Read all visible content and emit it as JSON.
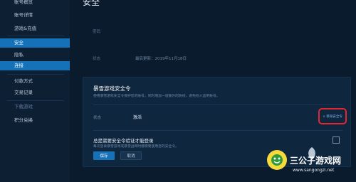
{
  "sidebar": {
    "items": [
      {
        "label": "账号概览"
      },
      {
        "label": "账号详情"
      },
      {
        "label": "游戏&充值"
      },
      {
        "label": "安全"
      },
      {
        "label": "隐私"
      },
      {
        "label": "连接"
      },
      {
        "label": "付款方式"
      },
      {
        "label": "交易记录"
      },
      {
        "label": "下载游戏"
      },
      {
        "label": "积分兑换"
      }
    ]
  },
  "page": {
    "title": "安全",
    "password_label": "密码",
    "updated_label": "状态",
    "updated_value": "最后更新：2019年11月18日"
  },
  "authenticator": {
    "title": "暴雪游戏安全令",
    "description": "使用暴雪游戏安全令保护您的账号，同时增加一道额外的防线，避免他人盗用账号。",
    "state_label": "状态",
    "state_value": "激活",
    "remove_label": "× 移除安全令",
    "require_title": "总是需要安全令验证才能登录",
    "require_desc": "每次登录暴雪游戏或暴雪战网时都需要使用您的安全令。",
    "save_label": "保存",
    "cancel_label": "取消"
  },
  "watermark": {
    "title": "三公子游戏网",
    "url": "www.sangongzi.net"
  },
  "colors": {
    "accent": "#1672b8",
    "highlight": "#e3262f",
    "background": "#0b1b2e"
  }
}
